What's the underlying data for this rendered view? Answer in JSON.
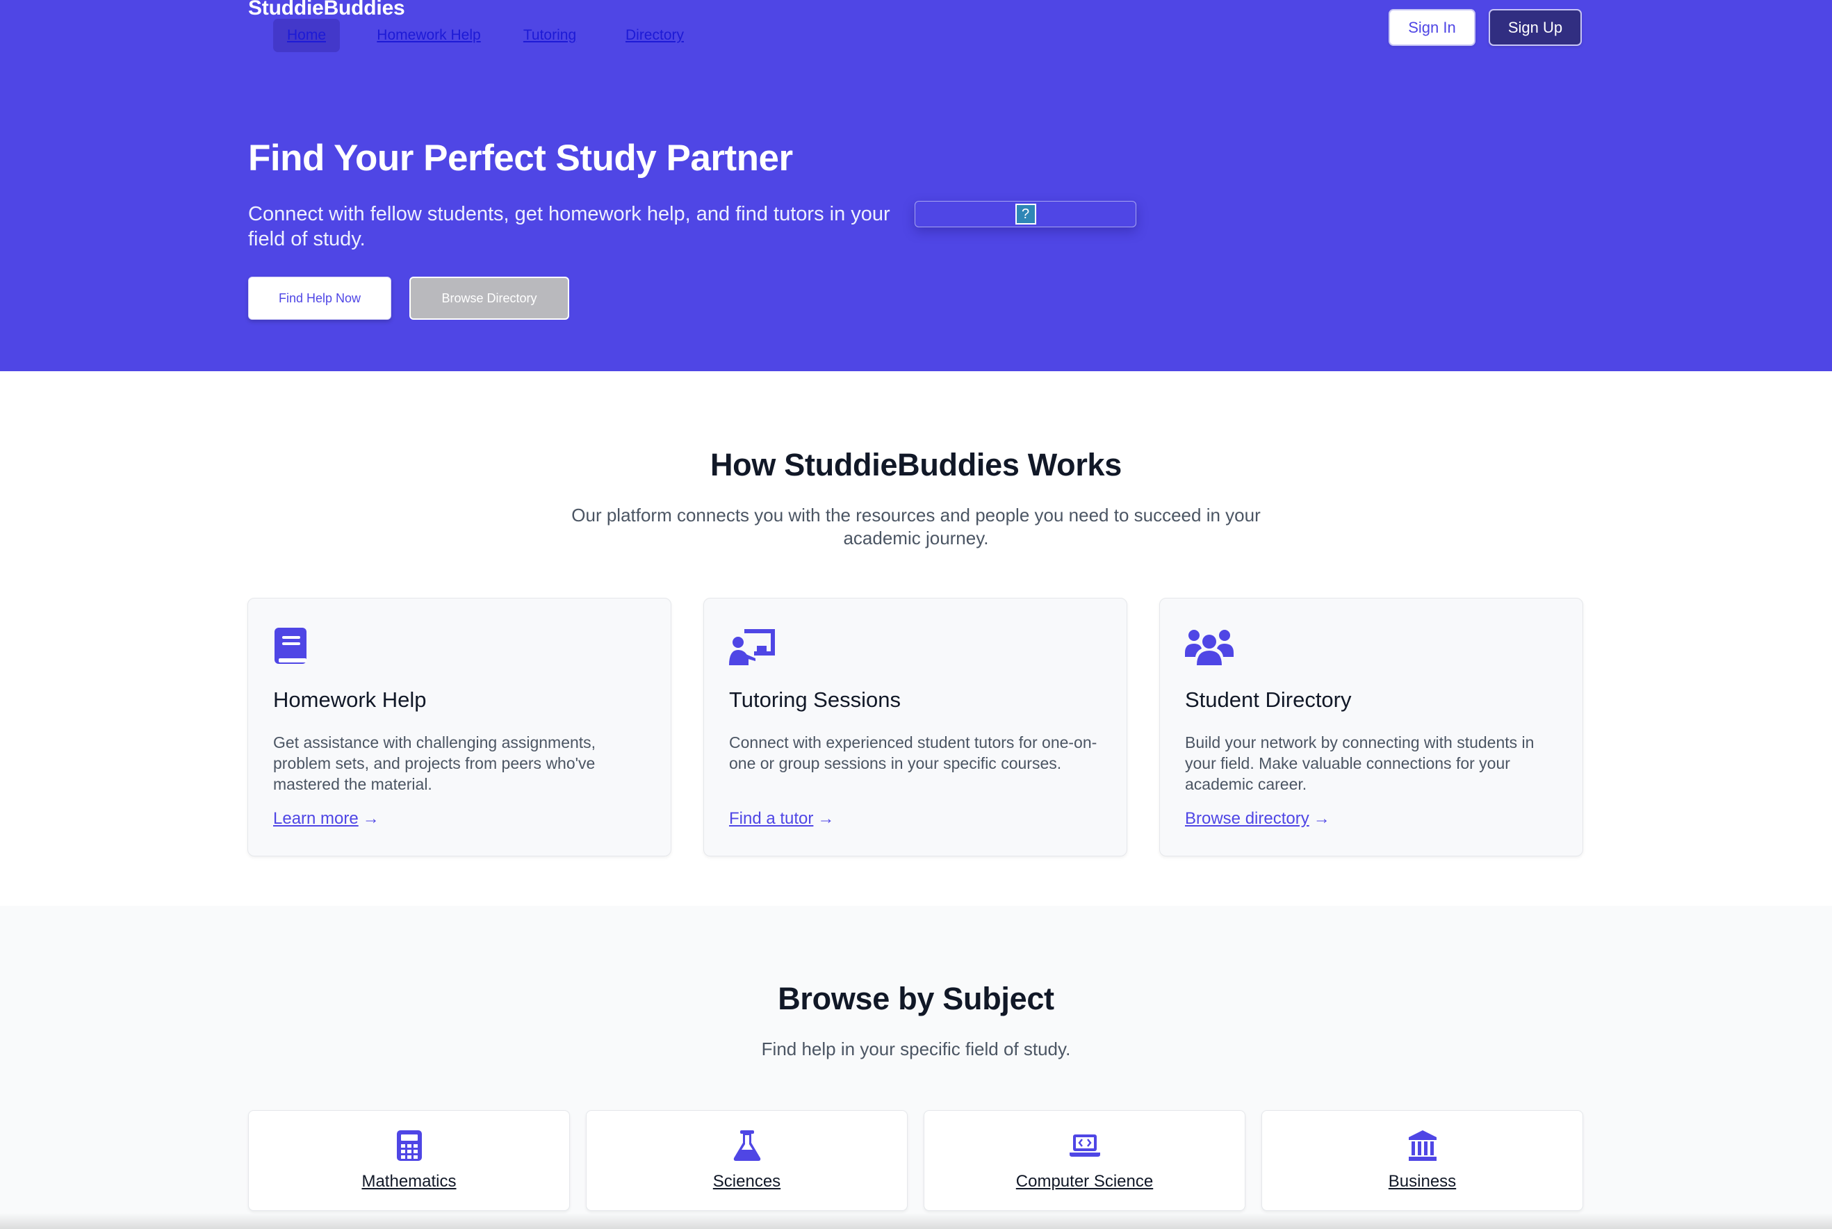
{
  "brand": "StuddieBuddies",
  "nav": {
    "items": [
      {
        "label": "Home",
        "active": true
      },
      {
        "label": "Homework Help",
        "active": false
      },
      {
        "label": "Tutoring",
        "active": false
      },
      {
        "label": "Directory",
        "active": false
      }
    ]
  },
  "auth": {
    "sign_in": "Sign In",
    "sign_up": "Sign Up"
  },
  "hero": {
    "title": "Find Your Perfect Study Partner",
    "subtitle": "Connect with fellow students, get homework help, and find tutors in your field of study.",
    "image_placeholder": "?",
    "primary_button": "Find Help Now",
    "secondary_button": "Browse Directory"
  },
  "how": {
    "title": "How StuddieBuddies Works",
    "subtitle": "Our platform connects you with the resources and people you need to succeed in your academic journey.",
    "cards": [
      {
        "icon": "book-icon",
        "title": "Homework Help",
        "text": "Get assistance with challenging assignments, problem sets, and projects from peers who've mastered the material.",
        "link": "Learn more"
      },
      {
        "icon": "chalkboard-teacher-icon",
        "title": "Tutoring Sessions",
        "text": "Connect with experienced student tutors for one-on-one or group sessions in your specific courses.",
        "link": "Find a tutor"
      },
      {
        "icon": "users-icon",
        "title": "Student Directory",
        "text": "Build your network by connecting with students in your field. Make valuable connections for your academic career.",
        "link": "Browse directory"
      }
    ]
  },
  "subjects": {
    "title": "Browse by Subject",
    "subtitle": "Find help in your specific field of study.",
    "items": [
      {
        "icon": "calculator-icon",
        "label": "Mathematics"
      },
      {
        "icon": "flask-icon",
        "label": "Sciences"
      },
      {
        "icon": "laptop-code-icon",
        "label": "Computer Science"
      },
      {
        "icon": "landmark-icon",
        "label": "Business"
      }
    ]
  },
  "colors": {
    "brand": "#4f46e5",
    "brand_dark": "#312e81",
    "text": "#111827",
    "muted": "#4b5563"
  }
}
